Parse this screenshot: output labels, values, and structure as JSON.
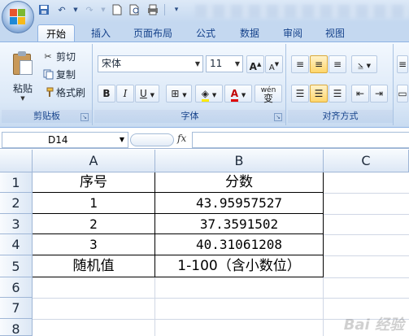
{
  "quick_access": {
    "items": [
      "save-icon",
      "undo-icon",
      "redo-icon",
      "new-file-icon",
      "print-preview-icon",
      "print-icon",
      "customize-icon"
    ]
  },
  "tabs": [
    {
      "label": "开始",
      "active": true
    },
    {
      "label": "插入"
    },
    {
      "label": "页面布局"
    },
    {
      "label": "公式"
    },
    {
      "label": "数据"
    },
    {
      "label": "审阅"
    },
    {
      "label": "视图"
    }
  ],
  "clipboard": {
    "paste_label": "粘贴",
    "cut_label": "剪切",
    "copy_label": "复制",
    "format_painter_label": "格式刷",
    "group_label": "剪贴板"
  },
  "font": {
    "font_name": "宋体",
    "font_size": "11",
    "grow_label": "A",
    "shrink_label": "A",
    "bold": "B",
    "italic": "I",
    "underline": "U",
    "font_color_label": "A",
    "phonetic_label": "wén\n变",
    "group_label": "字体"
  },
  "alignment": {
    "group_label": "对齐方式"
  },
  "formula_bar": {
    "name_box": "D14",
    "fx": "fx",
    "value": ""
  },
  "columns": [
    "A",
    "B",
    "C"
  ],
  "rows": [
    "1",
    "2",
    "3",
    "4",
    "5",
    "6",
    "7",
    "8"
  ],
  "cells": [
    [
      "序号",
      "分数"
    ],
    [
      "1",
      "43.95957527"
    ],
    [
      "2",
      "37.3591502"
    ],
    [
      "3",
      "40.31061208"
    ],
    [
      "随机值",
      "1-100（含小数位）"
    ]
  ],
  "watermark": "Bai 经验",
  "colors": {
    "ribbon": "#dbe8f7",
    "accent": "#15428b",
    "highlight": "#ffd66b"
  }
}
